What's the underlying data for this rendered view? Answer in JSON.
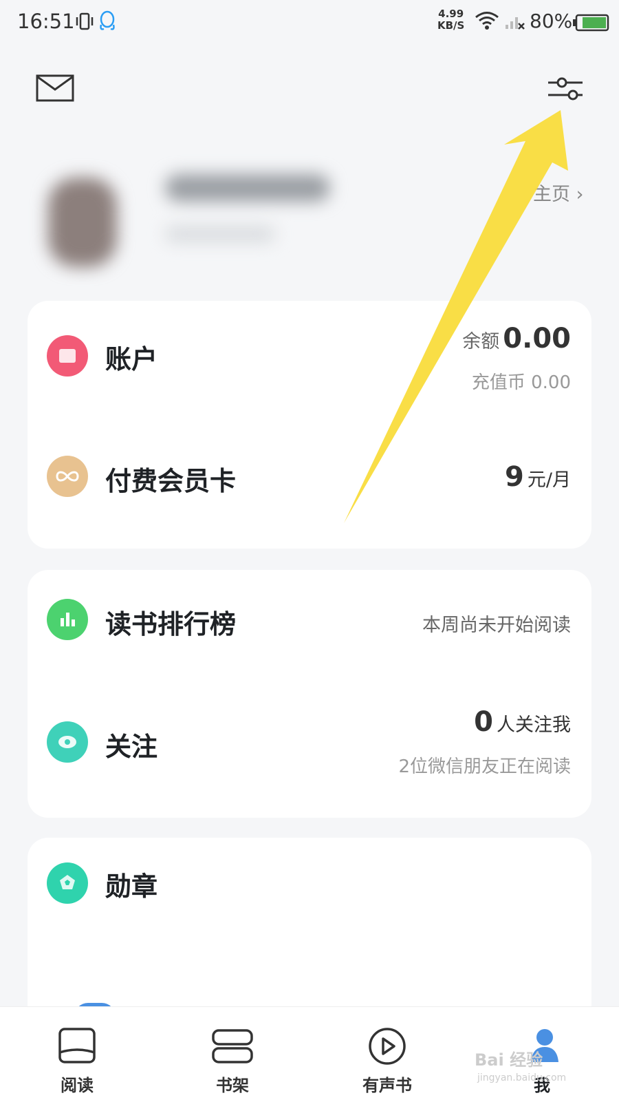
{
  "status_bar": {
    "time": "16:51",
    "speed_value": "4.99",
    "speed_unit": "KB/S",
    "battery": "80%"
  },
  "profile": {
    "homepage_link": "主页 ›"
  },
  "account_card": {
    "account_label": "账户",
    "balance_label": "余额",
    "balance_value": "0.00",
    "coins_text": "充值币 0.00",
    "member_label": "付费会员卡",
    "member_price": "9",
    "member_unit": "元/月"
  },
  "social_card": {
    "rank_label": "读书排行榜",
    "rank_status": "本周尚未开始阅读",
    "follow_label": "关注",
    "follower_count": "0",
    "follower_text": "人关注我",
    "friends_reading": "2位微信朋友正在阅读"
  },
  "badge_card": {
    "badge_label": "勋章"
  },
  "tabs": [
    {
      "label": "阅读",
      "icon": "book-open-icon"
    },
    {
      "label": "书架",
      "icon": "bookshelf-icon"
    },
    {
      "label": "有声书",
      "icon": "play-circle-icon"
    },
    {
      "label": "我",
      "icon": "user-icon"
    }
  ],
  "colors": {
    "account": "#f25a76",
    "member": "#e8c290",
    "rank": "#4cd26f",
    "follow": "#3fd1b9",
    "badge": "#2fd3ad",
    "arrow": "#f9dc3c"
  },
  "watermark": {
    "text": "Bai 经验",
    "sub": "jingyan.baidu.com"
  }
}
